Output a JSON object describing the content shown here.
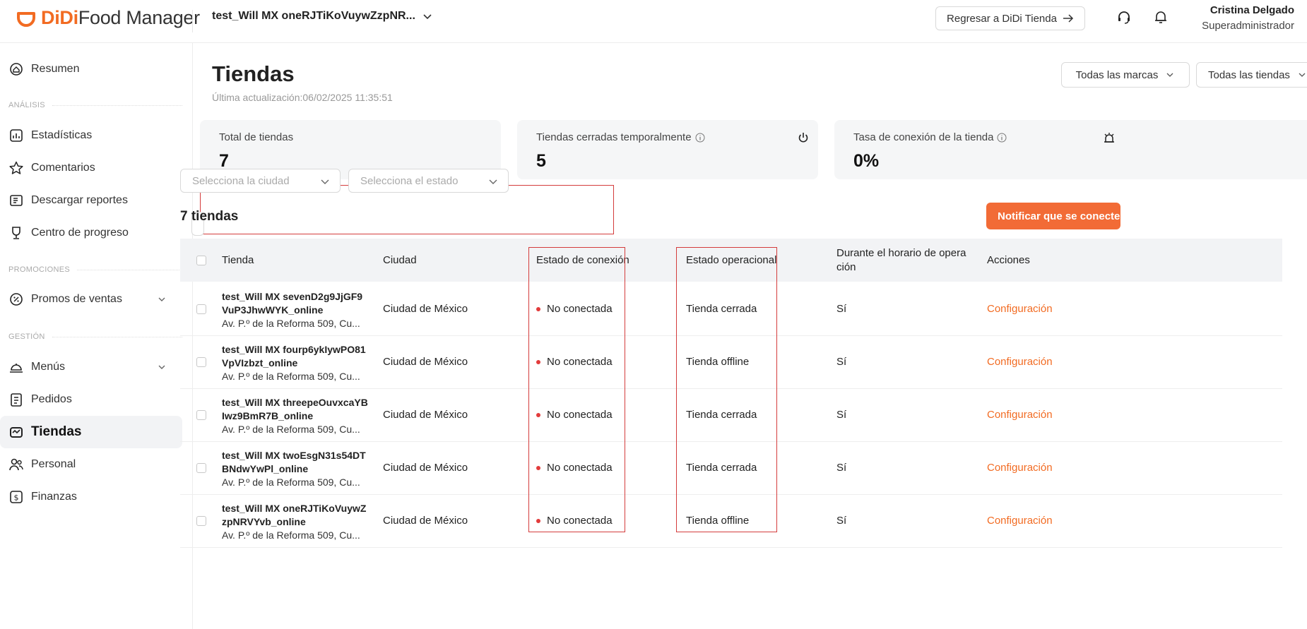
{
  "header": {
    "logo_brand": "DiDi",
    "logo_product": "Food Manager",
    "store_selector": "test_Will MX oneRJTiKoVuywZzpNR...",
    "return_button": "Regresar a DiDi Tienda",
    "user_name": "Cristina Delgado",
    "user_role": "Superadministrador",
    "accent_color": "#f26b22"
  },
  "sidebar": {
    "resumen": "Resumen",
    "section_analisis": "ANÁLISIS",
    "estadisticas": "Estadísticas",
    "comentarios": "Comentarios",
    "descargar": "Descargar reportes",
    "progreso": "Centro de progreso",
    "section_promociones": "PROMOCIONES",
    "promos": "Promos de ventas",
    "section_gestion": "GESTIÓN",
    "menus": "Menús",
    "pedidos": "Pedidos",
    "tiendas": "Tiendas",
    "personal": "Personal",
    "finanzas": "Finanzas"
  },
  "page": {
    "title": "Tiendas",
    "last_update": "Última actualización:06/02/2025 11:35:51",
    "brand_filter": "Todas las marcas",
    "store_filter": "Todas las tiendas"
  },
  "stats": {
    "total_label": "Total de tiendas",
    "total_value": "7",
    "closed_label": "Tiendas cerradas temporalmente",
    "closed_value": "5",
    "rate_label": "Tasa de conexión de la tienda",
    "rate_value": "0%"
  },
  "filters": {
    "city_placeholder": "Selecciona la ciudad",
    "state_placeholder": "Selecciona el estado"
  },
  "list": {
    "count_title": "7 tiendas",
    "notify_button": "Notificar que se conecte(n)"
  },
  "table": {
    "headers": {
      "store": "Tienda",
      "city": "Ciudad",
      "connection": "Estado de conexión",
      "operational": "Estado operacional",
      "hours_line1": "Durante el horario de opera",
      "hours_line2": "ción",
      "actions": "Acciones"
    },
    "rows": [
      {
        "name1": "test_Will MX sevenD2g9JjGF9",
        "name2": "VuP3JhwWYK_online",
        "addr": "Av. P.º de la Reforma 509, Cu...",
        "city": "Ciudad de México",
        "connection": "No conectada",
        "operational": "Tienda cerrada",
        "hours": "Sí",
        "action": "Configuración"
      },
      {
        "name1": "test_Will MX fourp6ykIywPO81",
        "name2": "VpVIzbzt_online",
        "addr": "Av. P.º de la Reforma 509, Cu...",
        "city": "Ciudad de México",
        "connection": "No conectada",
        "operational": "Tienda offline",
        "hours": "Sí",
        "action": "Configuración"
      },
      {
        "name1": "test_Will MX threepeOuvxcaYB",
        "name2": "Iwz9BmR7B_online",
        "addr": "Av. P.º de la Reforma 509, Cu...",
        "city": "Ciudad de México",
        "connection": "No conectada",
        "operational": "Tienda cerrada",
        "hours": "Sí",
        "action": "Configuración"
      },
      {
        "name1": "test_Will MX twoEsgN31s54DT",
        "name2": "BNdwYwPl_online",
        "addr": "Av. P.º de la Reforma 509, Cu...",
        "city": "Ciudad de México",
        "connection": "No conectada",
        "operational": "Tienda cerrada",
        "hours": "Sí",
        "action": "Configuración"
      },
      {
        "name1": "test_Will MX oneRJTiKoVuywZ",
        "name2": "zpNRVYvb_online",
        "addr": "Av. P.º de la Reforma 509, Cu...",
        "city": "Ciudad de México",
        "connection": "No conectada",
        "operational": "Tienda offline",
        "hours": "Sí",
        "action": "Configuración"
      }
    ]
  }
}
